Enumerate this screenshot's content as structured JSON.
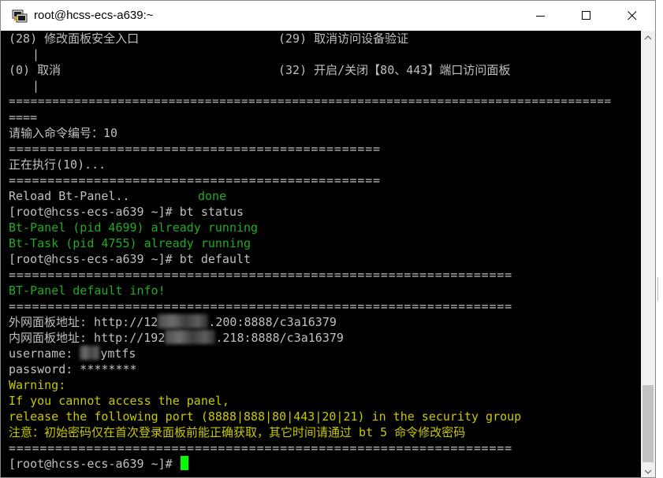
{
  "window": {
    "title": "root@hcss-ecs-a639:~",
    "buttons": {
      "minimize": "minimize-icon",
      "maximize": "maximize-icon",
      "close": "close-icon"
    }
  },
  "colors": {
    "green": "#22aa22",
    "yellow": "#c8c800",
    "gray": "#c0c0c0",
    "cursor": "#00ff00"
  },
  "terminal": {
    "menu_28": "(28) 修改面板安全入口",
    "menu_29": "(29) 取消访问设备验证",
    "pipe": "|",
    "menu_0": "(0) 取消",
    "menu_32": "(32) 开启/关闭【80、443】端口访问面板",
    "sep_long": "===================================================================================",
    "sep_tail": "====",
    "prompt_input": "请输入命令编号：10",
    "sep_mid": "================================================",
    "executing": "正在执行(10)...",
    "reload": "Reload Bt-Panel..",
    "done": "done",
    "shell_prompt": "[root@hcss-ecs-a639 ~]#",
    "cmd_status": "bt status",
    "panel_running": "Bt-Panel (pid 4699) already running",
    "task_running": "Bt-Task (pid 4755) already running",
    "cmd_default": "bt default",
    "sep_wide": "=================================================================",
    "default_info": "BT-Panel default info!",
    "ext_label": "外网面板地址: http://12",
    "ext_tail": ".200:8888/c3a16379",
    "int_label": "内网面板地址: http://192",
    "int_tail": ".218:8888/c3a16379",
    "username_label": "username: ",
    "username_tail": "ymtfs",
    "password_line": "password: ********",
    "warning": "Warning:",
    "warn1": "If you cannot access the panel,",
    "warn2": "release the following port (8888|888|80|443|20|21) in the security group",
    "notice": "注意：初始密码仅在首次登录面板前能正确获取，其它时间请通过 bt 5 命令修改密码"
  }
}
